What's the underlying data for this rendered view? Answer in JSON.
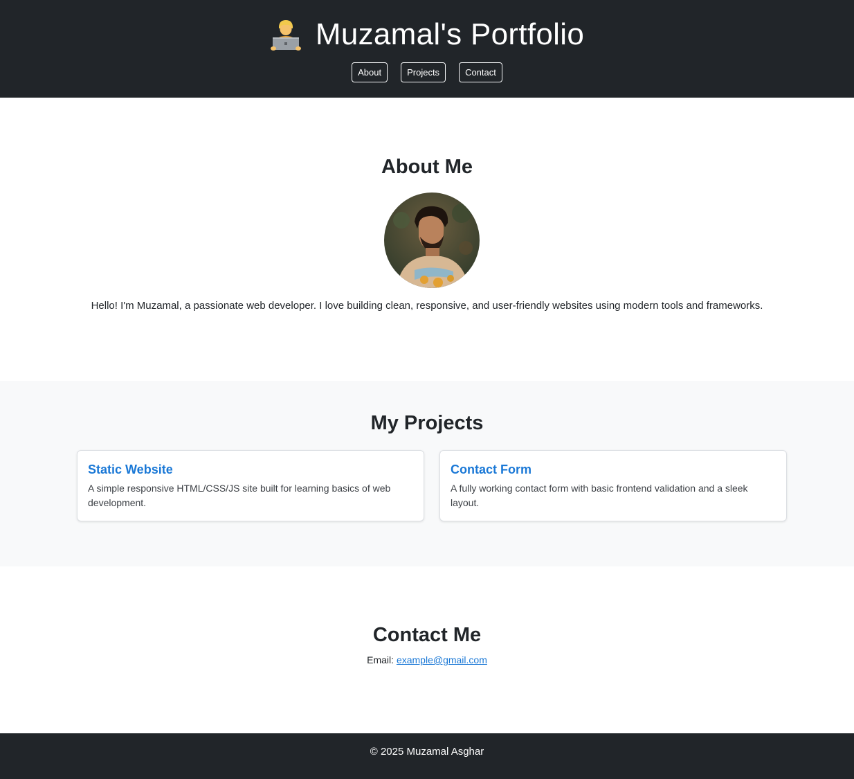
{
  "header": {
    "icon": "technologist-emoji-icon",
    "title": "Muzamal's Portfolio",
    "nav": [
      {
        "label": "About"
      },
      {
        "label": "Projects"
      },
      {
        "label": "Contact"
      }
    ],
    "background": "#212529"
  },
  "about": {
    "heading": "About Me",
    "avatar": "profile-photo",
    "text": "Hello! I'm Muzamal, a passionate web developer. I love building clean, responsive, and user-friendly websites using modern tools and frameworks."
  },
  "projects": {
    "heading": "My Projects",
    "cards": [
      {
        "title": "Static Website",
        "description": "A simple responsive HTML/CSS/JS site built for learning basics of web development."
      },
      {
        "title": "Contact Form",
        "description": "A fully working contact form with basic frontend validation and a sleek layout."
      }
    ],
    "accent": "#1a78d6"
  },
  "contact": {
    "heading": "Contact Me",
    "email_label": "Email: ",
    "email": "example@gmail.com"
  },
  "footer": {
    "text": "© 2025 Muzamal Asghar"
  }
}
